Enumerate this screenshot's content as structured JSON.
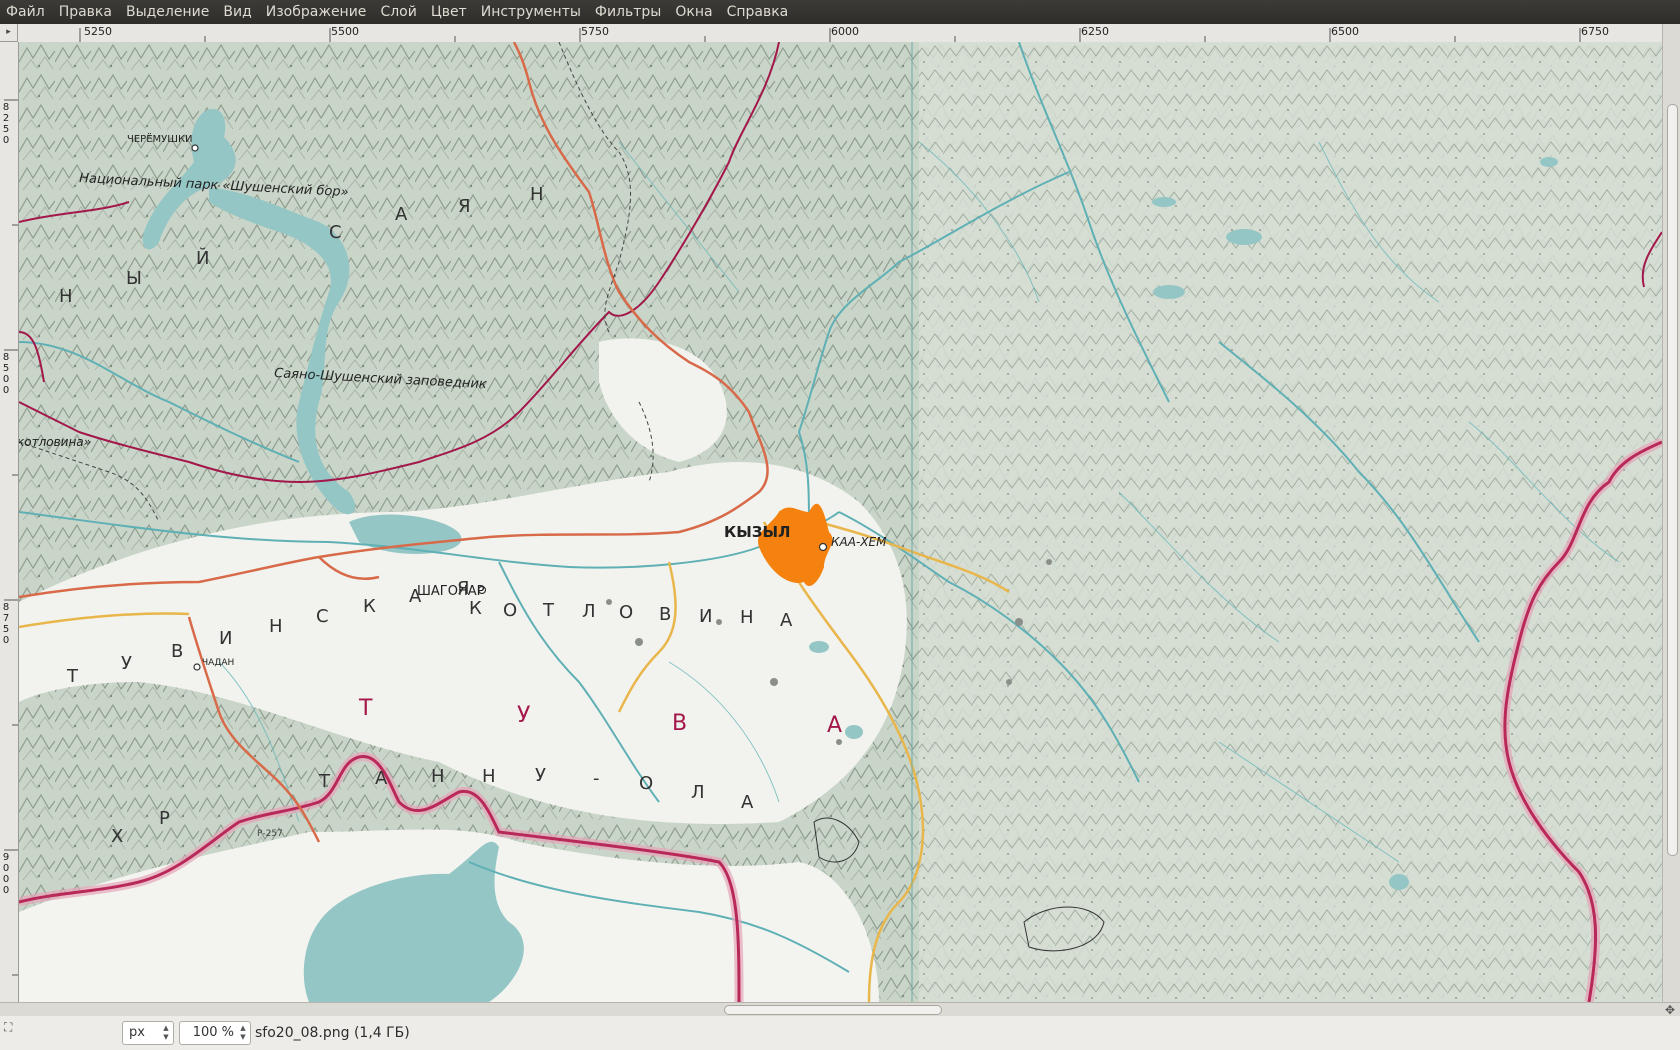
{
  "menu": [
    "Файл",
    "Правка",
    "Выделение",
    "Вид",
    "Изображение",
    "Слой",
    "Цвет",
    "Инструменты",
    "Фильтры",
    "Окна",
    "Справка"
  ],
  "ruler": {
    "h_labels": [
      "5250",
      "5500",
      "5750",
      "6000",
      "6250",
      "6500",
      "6750"
    ],
    "v_labels": [
      "8\n2\n5\n0",
      "8\n5\n0\n0",
      "8\n7\n5\n0",
      "9\n0\n0\n0"
    ]
  },
  "map": {
    "labels": {
      "cheremushki": "ЧЕРЁМУШКИ",
      "park": "Национальный парк «Шушенский бор»",
      "reserve": "Саяно-Шушенский заповедник",
      "kotlovina_cut": "котловина»",
      "kyzyl": "КЫЗЫЛ",
      "kaa_hem": "КАА-ХЕМ",
      "shagonar": "ШАГОНАР",
      "chadan": "ЧАДАН",
      "r257": "Р-257"
    },
    "sayan_letters": [
      "Н",
      "Ы",
      "Й",
      "С",
      "А",
      "Я",
      "Н"
    ],
    "basin_letters": [
      "Т",
      "У",
      "В",
      "И",
      "Н",
      "С",
      "К",
      "А",
      "Я",
      "К",
      "О",
      "Т",
      "Л",
      "О",
      "В",
      "И",
      "Н",
      "А"
    ],
    "tuva_letters": [
      "Т",
      "У",
      "В",
      "А"
    ],
    "tannu_letters": [
      "Т",
      "А",
      "Н",
      "Н",
      "У",
      "-",
      "О",
      "Л",
      "А"
    ],
    "khr_letters": [
      "Х",
      "Р"
    ],
    "colors": {
      "water": "#95c6c6",
      "river": "#5fb0b5",
      "road_red": "#d86a4a",
      "road_yellow": "#e8b64a",
      "border_regional": "#a3174b",
      "border_state": "#b8295a",
      "city": "#f5820f",
      "label_red": "#a3174b"
    }
  },
  "status": {
    "unit": "px",
    "zoom": "100 %",
    "file": "sfo20_08.png (1,4 ГБ)"
  }
}
